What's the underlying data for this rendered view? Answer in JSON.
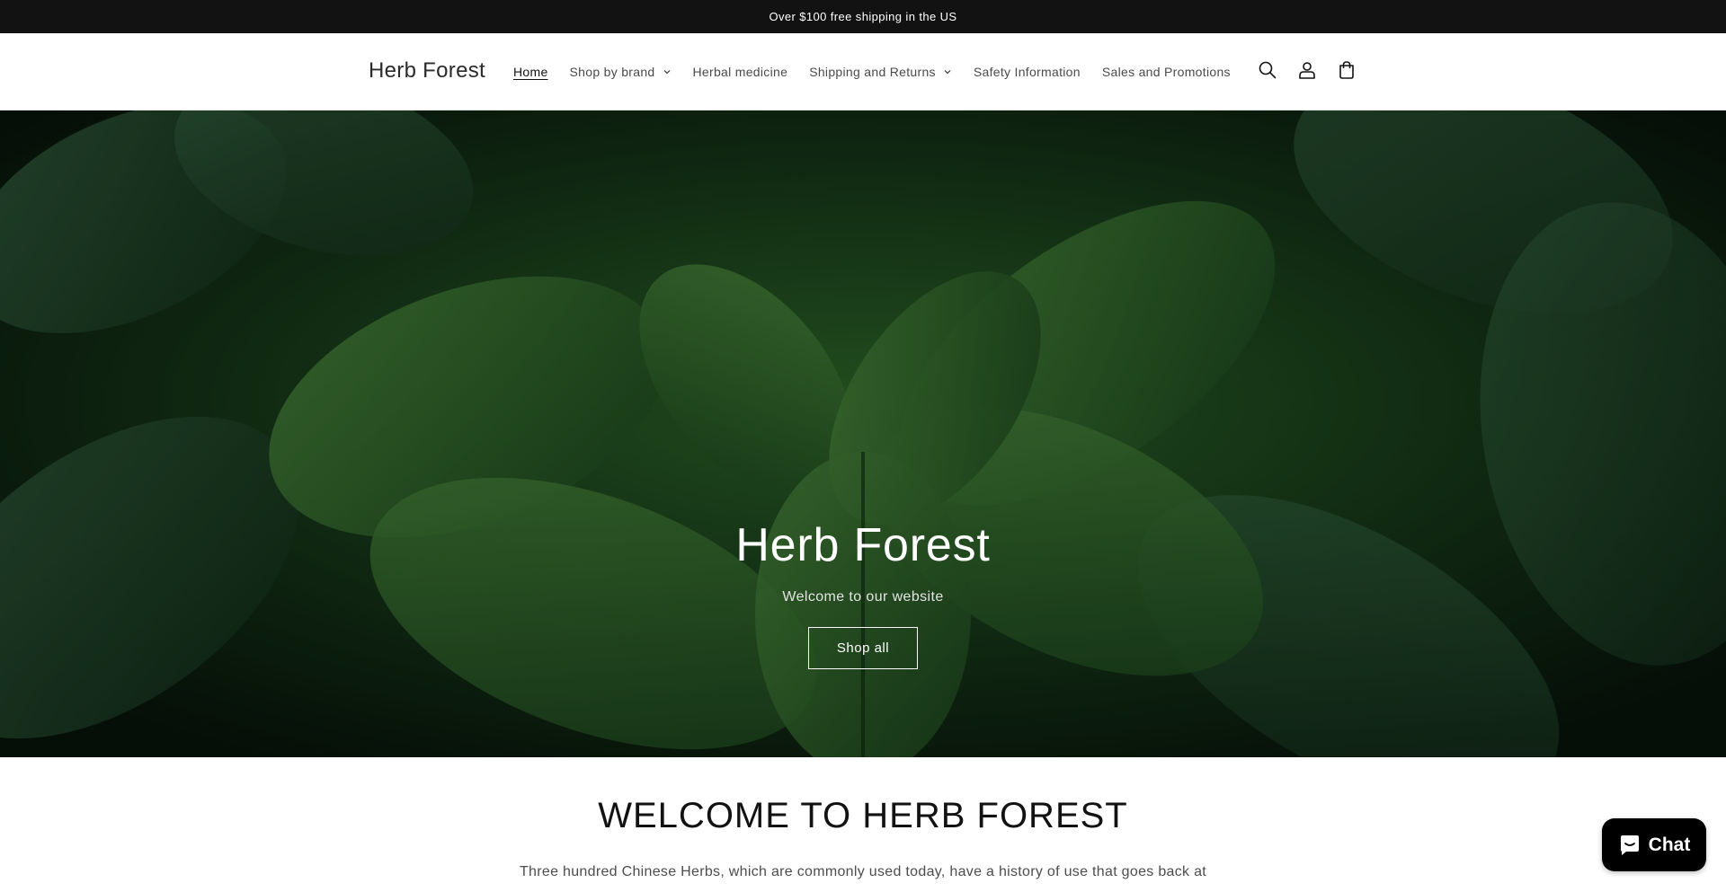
{
  "announcement": {
    "text": "Over $100 free shipping in the US"
  },
  "header": {
    "logo": "Herb Forest",
    "nav": [
      {
        "label": "Home",
        "active": true,
        "has_dropdown": false
      },
      {
        "label": "Shop by brand",
        "active": false,
        "has_dropdown": true
      },
      {
        "label": "Herbal medicine",
        "active": false,
        "has_dropdown": false
      },
      {
        "label": "Shipping and Returns",
        "active": false,
        "has_dropdown": true
      },
      {
        "label": "Safety Information",
        "active": false,
        "has_dropdown": false
      },
      {
        "label": "Sales and Promotions",
        "active": false,
        "has_dropdown": false
      }
    ],
    "icons": [
      "search-icon",
      "account-icon",
      "cart-icon"
    ]
  },
  "hero": {
    "title": "Herb Forest",
    "subtitle": "Welcome to our website",
    "button_label": "Shop all"
  },
  "welcome": {
    "title": "WELCOME TO HERB FOREST",
    "text": "Three hundred Chinese Herbs, which are commonly used today, have a history of use that goes back at least"
  },
  "chat": {
    "label": "Chat"
  },
  "colors": {
    "announcement_bg": "#121212",
    "chat_bg": "#000000",
    "leaf_green": "#2f6b2a"
  }
}
